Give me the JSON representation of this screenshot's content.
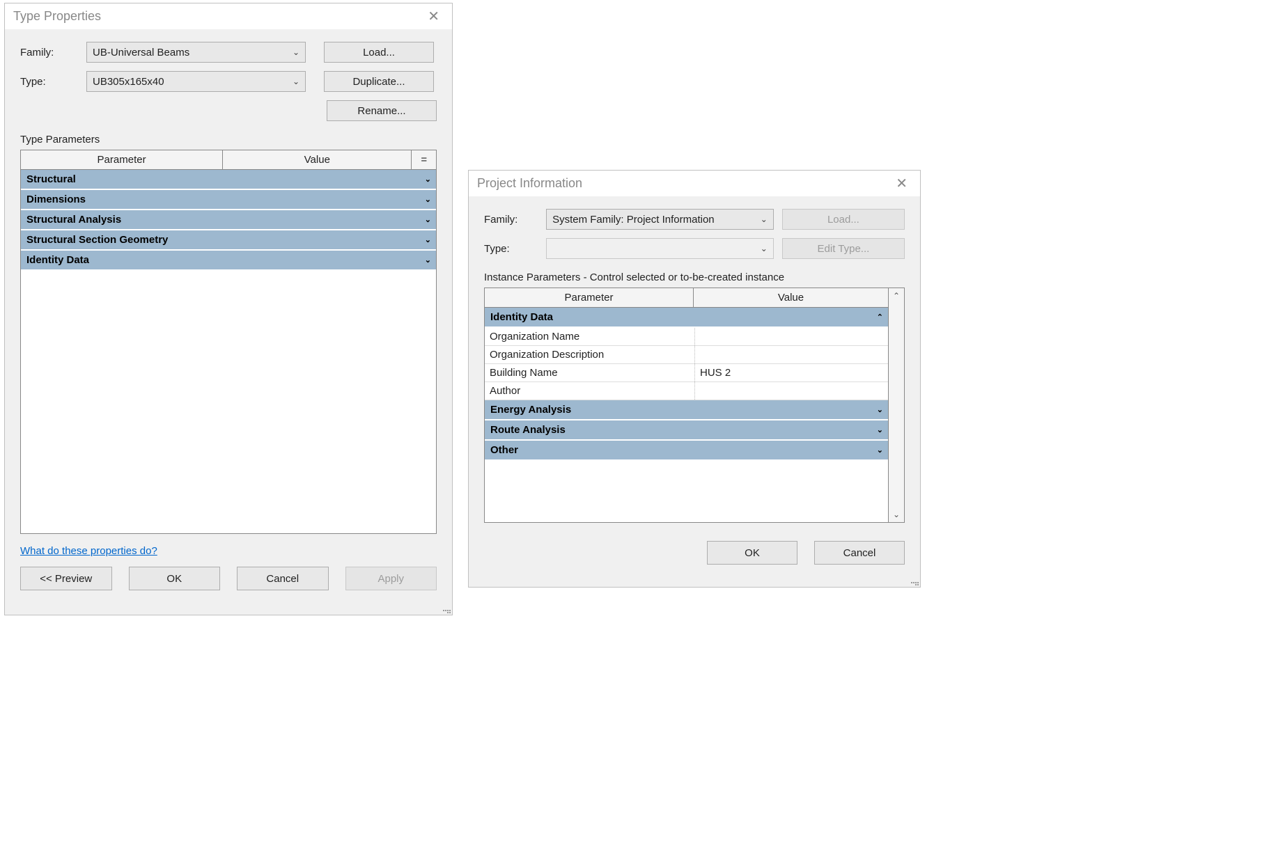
{
  "dialog1": {
    "title": "Type Properties",
    "family_label": "Family:",
    "family_value": "UB-Universal Beams",
    "type_label": "Type:",
    "type_value": "UB305x165x40",
    "load_btn": "Load...",
    "duplicate_btn": "Duplicate...",
    "rename_btn": "Rename...",
    "type_params_label": "Type Parameters",
    "col_parameter": "Parameter",
    "col_value": "Value",
    "col_eq": "=",
    "groups": [
      "Structural",
      "Dimensions",
      "Structural Analysis",
      "Structural Section Geometry",
      "Identity Data"
    ],
    "help_link": "What do these properties do?",
    "preview_btn": "<< Preview",
    "ok_btn": "OK",
    "cancel_btn": "Cancel",
    "apply_btn": "Apply"
  },
  "dialog2": {
    "title": "Project Information",
    "family_label": "Family:",
    "family_value": "System Family: Project Information",
    "type_label": "Type:",
    "type_value": "",
    "load_btn": "Load...",
    "edit_type_btn": "Edit Type...",
    "instance_label": "Instance Parameters - Control selected or to-be-created instance",
    "col_parameter": "Parameter",
    "col_value": "Value",
    "group_identity": "Identity Data",
    "rows": [
      {
        "param": "Organization Name",
        "value": ""
      },
      {
        "param": "Organization Description",
        "value": ""
      },
      {
        "param": "Building Name",
        "value": "HUS 2"
      },
      {
        "param": "Author",
        "value": ""
      }
    ],
    "group_energy": "Energy Analysis",
    "group_route": "Route Analysis",
    "group_other": "Other",
    "ok_btn": "OK",
    "cancel_btn": "Cancel"
  }
}
